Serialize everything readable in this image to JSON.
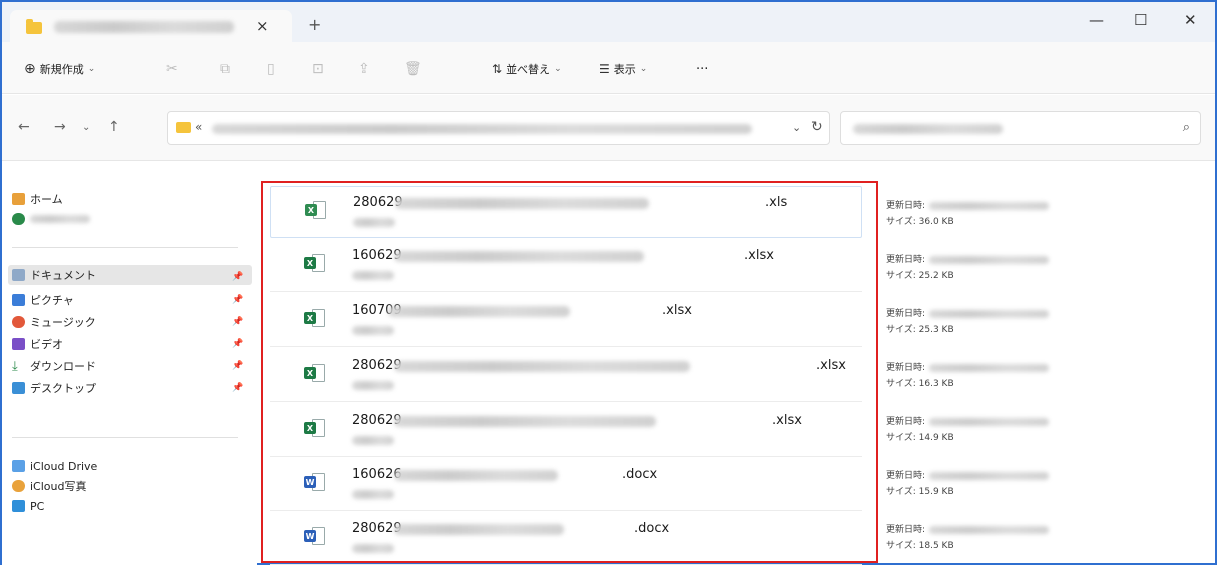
{
  "window": {
    "new_tab": "+",
    "close_tab": "×",
    "minimize": "—",
    "maximize": "☐",
    "close": "✕"
  },
  "toolbar": {
    "new_label": "新規作成",
    "sort_label": "並べ替え",
    "view_label": "表示",
    "more_label": "···"
  },
  "sidebar": {
    "home": "ホーム",
    "documents": "ドキュメント",
    "pictures": "ピクチャ",
    "music": "ミュージック",
    "videos": "ビデオ",
    "downloads": "ダウンロード",
    "desktop": "デスクトップ",
    "icloud_drive": "iCloud Drive",
    "icloud_photos": "iCloud写真",
    "pc": "PC"
  },
  "meta_labels": {
    "modified": "更新日時:",
    "size": "サイズ:"
  },
  "files": [
    {
      "name": "280629",
      "ext": ".xls",
      "type": "xls",
      "badge": "X",
      "size": "36.0 KB"
    },
    {
      "name": "160629",
      "ext": ".xlsx",
      "type": "xlsx",
      "badge": "X",
      "size": "25.2 KB"
    },
    {
      "name": "160709",
      "ext": ".xlsx",
      "type": "xlsx",
      "badge": "X",
      "size": "25.3 KB"
    },
    {
      "name": "280629",
      "ext": ".xlsx",
      "type": "xlsx",
      "badge": "X",
      "size": "16.3 KB"
    },
    {
      "name": "280629",
      "ext": ".xlsx",
      "type": "xlsx",
      "badge": "X",
      "size": "14.9 KB"
    },
    {
      "name": "160626",
      "ext": ".docx",
      "type": "docx",
      "badge": "W",
      "size": "15.9 KB"
    },
    {
      "name": "280629",
      "ext": ".docx",
      "type": "docx",
      "badge": "W",
      "size": "18.5 KB"
    }
  ],
  "colors": {
    "accent": "#2f6fd0",
    "highlight_box": "#e02020",
    "excel": "#1d7a45",
    "word": "#2b5fb8"
  }
}
